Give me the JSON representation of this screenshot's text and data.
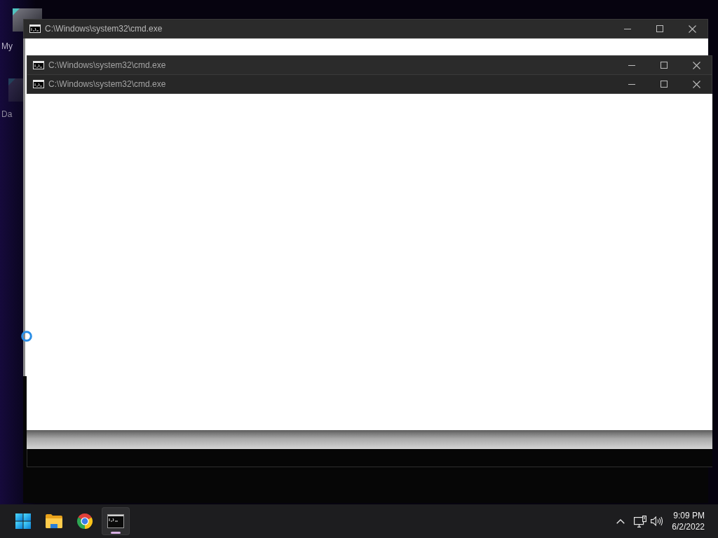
{
  "desktop": {
    "icons": [
      {
        "label": "My"
      },
      {
        "label": "Da"
      }
    ]
  },
  "windows": [
    {
      "title": "C:\\Windows\\system32\\cmd.exe"
    },
    {
      "title": "C:\\Windows\\system32\\cmd.exe"
    },
    {
      "title": "C:\\Windows\\system32\\cmd.exe"
    }
  ],
  "taskbar": {
    "apps": [
      {
        "kind": "start",
        "selected": false
      },
      {
        "kind": "folder",
        "selected": false
      },
      {
        "kind": "browser",
        "selected": false
      },
      {
        "kind": "terminal",
        "selected": true
      }
    ],
    "clock": {
      "time": "9:09 PM",
      "date": "6/2/2022"
    }
  }
}
